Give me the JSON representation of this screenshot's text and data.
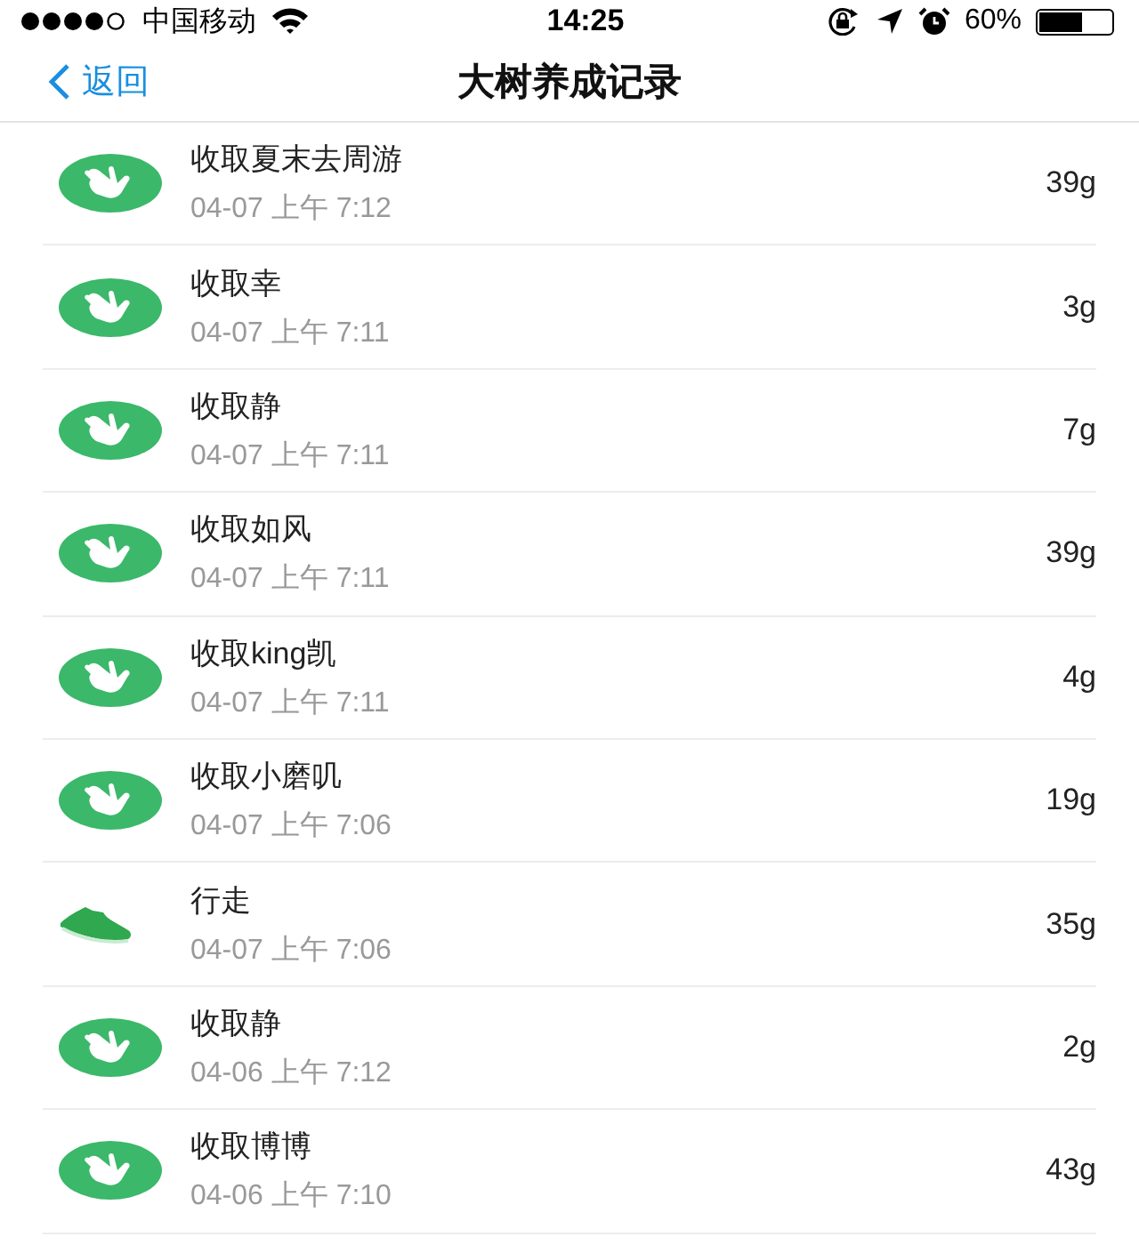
{
  "status_bar": {
    "carrier": "中国移动",
    "time": "14:25",
    "battery": "60%"
  },
  "nav": {
    "back": "返回",
    "title": "大树养成记录"
  },
  "records": [
    {
      "kind": "collect",
      "title": "收取夏末去周游",
      "time": "04-07 上午 7:12",
      "amount": "39g"
    },
    {
      "kind": "collect",
      "title": "收取幸",
      "time": "04-07 上午 7:11",
      "amount": "3g"
    },
    {
      "kind": "collect",
      "title": "收取静",
      "time": "04-07 上午 7:11",
      "amount": "7g"
    },
    {
      "kind": "collect",
      "title": "收取如风",
      "time": "04-07 上午 7:11",
      "amount": "39g"
    },
    {
      "kind": "collect",
      "title": "收取king凯",
      "time": "04-07 上午 7:11",
      "amount": "4g"
    },
    {
      "kind": "collect",
      "title": "收取小磨叽",
      "time": "04-07 上午 7:06",
      "amount": "19g"
    },
    {
      "kind": "walk",
      "title": "行走",
      "time": "04-07 上午 7:06",
      "amount": "35g"
    },
    {
      "kind": "collect",
      "title": "收取静",
      "time": "04-06 上午 7:12",
      "amount": "2g"
    },
    {
      "kind": "collect",
      "title": "收取博博",
      "time": "04-06 上午 7:10",
      "amount": "43g"
    }
  ]
}
